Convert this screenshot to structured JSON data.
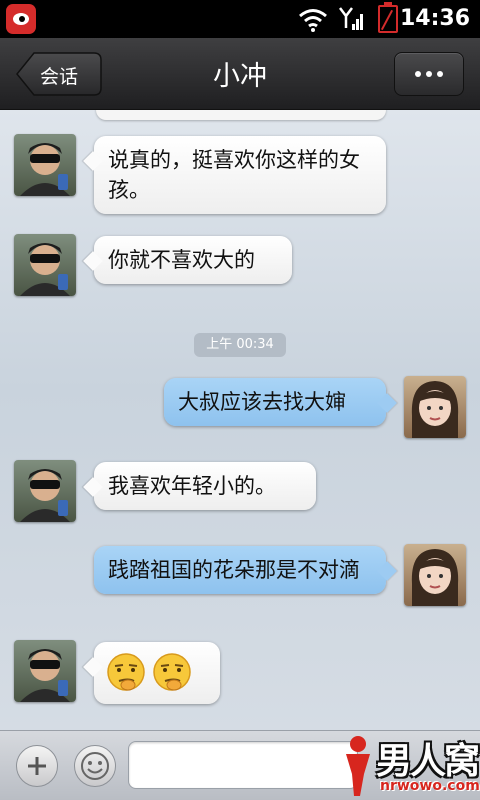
{
  "status_bar": {
    "time": "14:36",
    "icons": [
      "weibo-app-icon",
      "wifi-icon",
      "signal-icon",
      "battery-empty-icon"
    ],
    "battery_color": "#d32b2b"
  },
  "header": {
    "back_label": "会话",
    "title": "小冲",
    "more_icon": "more-dots-icon"
  },
  "messages": [
    {
      "sender": "other",
      "text": "说真的，挺喜欢你这样的女孩。"
    },
    {
      "sender": "other",
      "text": "你就不喜欢大的"
    },
    {
      "type": "timestamp",
      "text": "上午 00:34"
    },
    {
      "sender": "me",
      "text": "大叔应该去找大婶"
    },
    {
      "sender": "other",
      "text": "我喜欢年轻小的。"
    },
    {
      "sender": "me",
      "text": "践踏祖国的花朵那是不对滴"
    },
    {
      "sender": "other",
      "emoji": [
        "smug-emoji",
        "smug-emoji"
      ]
    }
  ],
  "composer": {
    "plus_icon": "plus-icon",
    "emoji_icon": "smiley-icon",
    "input_value": ""
  },
  "watermark": {
    "text": "男人窝",
    "url": "nrwowo.com"
  },
  "colors": {
    "incoming_bubble": "#ffffff",
    "outgoing_bubble": "#9dcbf2",
    "header_bg": "#2e2e30"
  }
}
